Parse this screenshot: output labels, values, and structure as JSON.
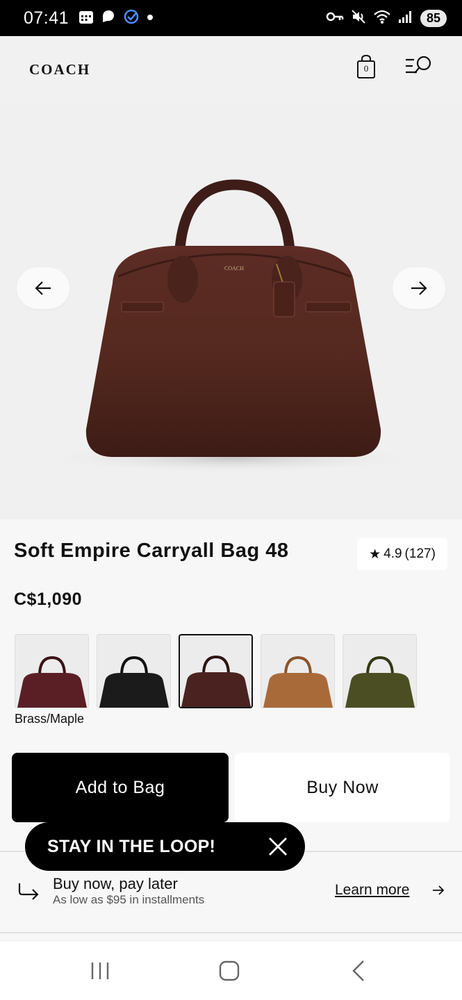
{
  "status_bar": {
    "time": "07:41",
    "battery": "85",
    "icons_left": [
      "calendar-icon",
      "chat-icon",
      "check-circle-icon",
      "dot-icon"
    ],
    "icons_right": [
      "key-icon",
      "mute-icon",
      "wifi-icon",
      "signal-icon"
    ]
  },
  "header": {
    "logo": "COACH",
    "bag_count": "0"
  },
  "product": {
    "title": "Soft Empire Carryall Bag 48",
    "price": "C$1,090",
    "rating": "4.9",
    "review_count": "(127)",
    "selected_color": "Brass/Maple",
    "swatches": [
      {
        "color": "#5a1f25"
      },
      {
        "color": "#1b1b1b"
      },
      {
        "color": "#4a2320"
      },
      {
        "color": "#a96a3a"
      },
      {
        "color": "#4a4e22"
      }
    ],
    "main_color": "#4f2620"
  },
  "actions": {
    "add_to_bag": "Add to Bag",
    "buy_now": "Buy Now"
  },
  "promo": {
    "loop_text": "STAY IN THE LOOP!"
  },
  "pay_later": {
    "title": "Buy now, pay later",
    "subtitle": "As low as $95 in installments",
    "learn_more": "Learn more"
  }
}
